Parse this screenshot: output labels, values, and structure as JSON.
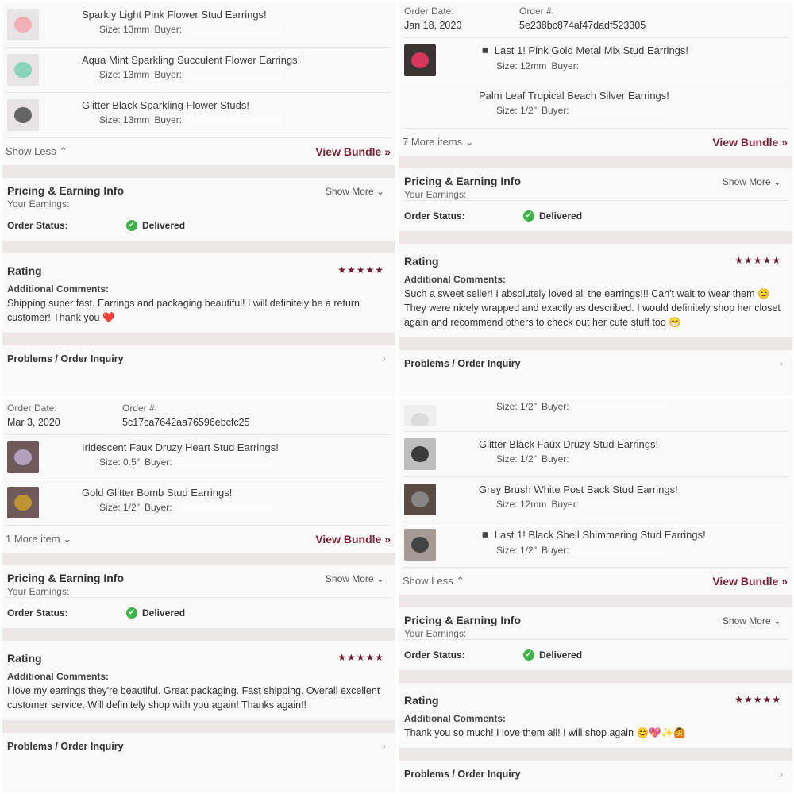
{
  "panels": [
    {
      "items": [
        {
          "title": "Sparkly Light Pink Flower Stud Earrings!",
          "size_label": "Size: 13mm",
          "buyer_label": "Buyer:",
          "thumb": "#f0a9b0"
        },
        {
          "title": "Aqua Mint Sparkling Succulent Flower Earrings!",
          "size_label": "Size: 13mm",
          "buyer_label": "Buyer:",
          "thumb": "#7fd0b6"
        },
        {
          "title": "Glitter Black Sparkling Flower Studs!",
          "size_label": "Size: 13mm",
          "buyer_label": "Buyer:",
          "thumb": "#555555"
        }
      ],
      "bundle_toggle": "Show Less ⌃",
      "view_bundle": "View Bundle »",
      "pricing_title": "Pricing & Earning Info",
      "show_more": "Show More ⌄",
      "earnings_label": "Your Earnings:",
      "status_label": "Order Status:",
      "status_value": "Delivered",
      "rating_title": "Rating",
      "stars": "★★★★★",
      "comments_label": "Additional Comments:",
      "comment": "Shipping super fast. Earrings and packaging beautiful! I will definitely be a return customer! Thank you ❤️",
      "problems": "Problems / Order Inquiry"
    },
    {
      "order_date_label": "Order Date:",
      "order_date": "Jan 18, 2020",
      "order_num_label": "Order #:",
      "order_num": "5e238bc874af47dadf523305",
      "items": [
        {
          "title": "◾ Last 1! Pink Gold Metal Mix Stud Earrings!",
          "size_label": "Size: 12mm",
          "buyer_label": "Buyer:",
          "thumb": "#e8375f"
        },
        {
          "title": "Palm Leaf Tropical Beach Silver Earrings!",
          "size_label": "Size: 1/2\"",
          "buyer_label": "Buyer:",
          "thumb": ""
        }
      ],
      "bundle_toggle": "7 More items ⌄",
      "view_bundle": "View Bundle »",
      "pricing_title": "Pricing & Earning Info",
      "show_more": "Show More ⌄",
      "earnings_label": "Your Earnings:",
      "status_label": "Order Status:",
      "status_value": "Delivered",
      "rating_title": "Rating",
      "stars": "★★★★★",
      "comments_label": "Additional Comments:",
      "comment": "Such a sweet seller! I absolutely loved all the earrings!!! Can't wait to wear them 😊 They were nicely wrapped and exactly as described. I would definitely shop her closet again and recommend others to check out her cute stuff too 😁",
      "problems": "Problems / Order Inquiry"
    },
    {
      "order_date_label": "Order Date:",
      "order_date": "Mar 3, 2020",
      "order_num_label": "Order #:",
      "order_num": "5c17ca7642aa76596ebcfc25",
      "items": [
        {
          "title": "Iridescent Faux Druzy Heart Stud Earrings!",
          "size_label": "Size: 0.5\"",
          "buyer_label": "Buyer:",
          "thumb": "#b9a7c4"
        },
        {
          "title": "Gold Glitter Bomb Stud Earrings!",
          "size_label": "Size: 1/2\"",
          "buyer_label": "Buyer:",
          "thumb": "#c79a2e"
        }
      ],
      "bundle_toggle": "1 More item ⌄",
      "view_bundle": "View Bundle »",
      "pricing_title": "Pricing & Earning Info",
      "show_more": "Show More ⌄",
      "earnings_label": "Your Earnings:",
      "status_label": "Order Status:",
      "status_value": "Delivered",
      "rating_title": "Rating",
      "stars": "★★★★★",
      "comments_label": "Additional Comments:",
      "comment": "I love my earrings they're beautiful. Great packaging. Fast shipping. Overall excellent customer service. Will definitely shop with you again! Thanks again!!",
      "problems": "Problems / Order Inquiry"
    },
    {
      "items": [
        {
          "title": "",
          "size_label": "Size: 1/2\"",
          "buyer_label": "Buyer:",
          "thumb": "#d9d9d9"
        },
        {
          "title": "Glitter Black Faux Druzy Stud Earrings!",
          "size_label": "Size: 1/2\"",
          "buyer_label": "Buyer:",
          "thumb": "#2b2b2b"
        },
        {
          "title": "Grey Brush White Post Back Stud Earrings!",
          "size_label": "Size: 12mm",
          "buyer_label": "Buyer:",
          "thumb": "#8c8c8c"
        },
        {
          "title": "◾ Last 1! Black Shell Shimmering Stud Earrings!",
          "size_label": "Size: 1/2\"",
          "buyer_label": "Buyer:",
          "thumb": "#3a3a3a"
        }
      ],
      "bundle_toggle": "Show Less ⌃",
      "view_bundle": "View Bundle »",
      "pricing_title": "Pricing & Earning Info",
      "show_more": "Show More ⌄",
      "earnings_label": "Your Earnings:",
      "status_label": "Order Status:",
      "status_value": "Delivered",
      "rating_title": "Rating",
      "stars": "★★★★★",
      "comments_label": "Additional Comments:",
      "comment": "Thank you so much! I love them all! I will shop again 😊💖✨🙆",
      "problems": "Problems / Order Inquiry"
    }
  ]
}
